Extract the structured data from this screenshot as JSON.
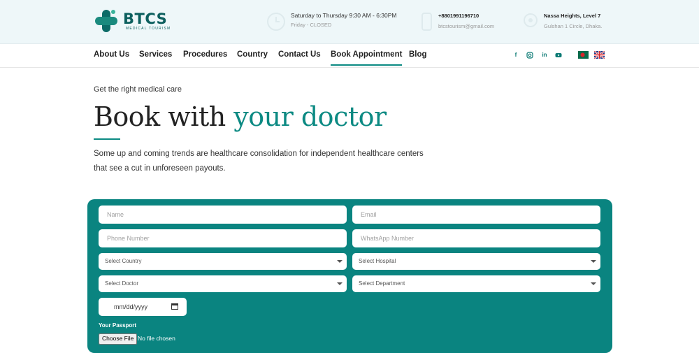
{
  "brand": {
    "name": "BTCS",
    "tagline": "MEDICAL TOURISM"
  },
  "topbar": {
    "hours": {
      "line1": "Saturday to Thursday 9:30 AM - 6:30PM",
      "line2": "Friday - CLOSED"
    },
    "contact": {
      "phone": "+8801991196710",
      "email": "btcstourism@gmail.com"
    },
    "address": {
      "line1": "Nassa Heights, Level 7",
      "line2": "Gulshan 1 Circle, Dhaka."
    }
  },
  "nav": {
    "items": [
      "About Us",
      "Services",
      "Procedures",
      "Country",
      "Contact Us",
      "Book Appointment",
      "Blog"
    ],
    "active": "Book Appointment",
    "social": [
      "facebook-icon",
      "instagram-icon",
      "linkedin-icon",
      "youtube-icon"
    ],
    "languages": [
      "Bangladesh",
      "English"
    ]
  },
  "hero": {
    "eyebrow": "Get the right medical care",
    "title_plain": "Book with ",
    "title_accent": "your doctor",
    "description": "Some up and coming trends are healthcare consolidation for independent healthcare centers that see a cut in unforeseen payouts."
  },
  "form": {
    "name_placeholder": "Name",
    "email_placeholder": "Email",
    "phone_placeholder": "Phone Number",
    "whatsapp_placeholder": "WhatsApp Number",
    "country_select": "Select Country",
    "hospital_select": "Select Hospital",
    "doctor_select": "Select Doctor",
    "department_select": "Select Department",
    "date_value": "mm/dd/yyyy",
    "passport_label": "Your Passport",
    "file_button": "Choose File",
    "file_status": "No file chosen"
  },
  "colors": {
    "brand": "#0c8a83",
    "form_bg": "#0a8480",
    "topbar_bg": "#eef7f9"
  }
}
